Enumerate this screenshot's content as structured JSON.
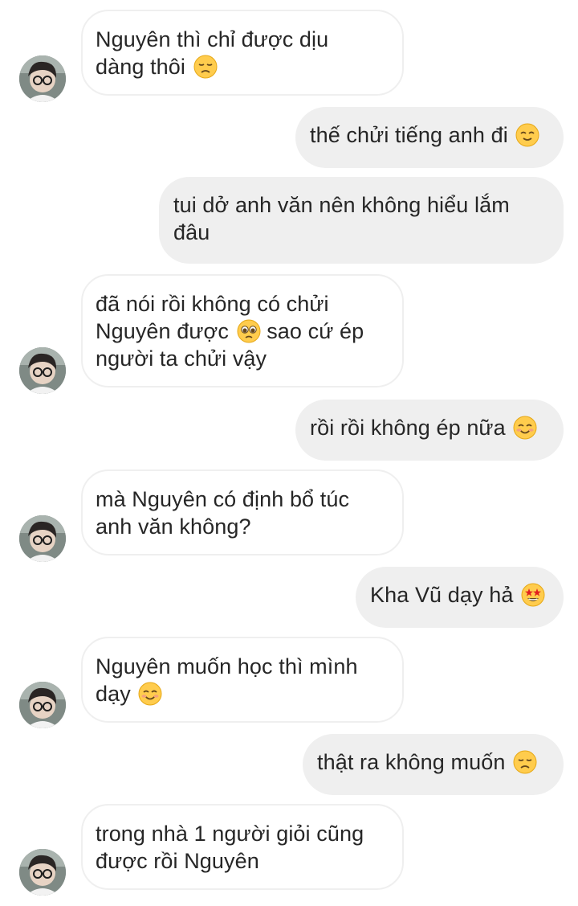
{
  "thread": {
    "messages": [
      {
        "side": "in",
        "lines": [
          "Nguyên thì chỉ được dịu",
          "dàng thôi"
        ],
        "emoji": "disappointed-face-icon",
        "avatar": true
      },
      {
        "side": "out",
        "lines": [
          "thế chửi tiếng anh đi"
        ],
        "emoji": "relieved-face-icon"
      },
      {
        "side": "out",
        "lines": [
          "tui dở anh văn nên không hiểu lắm",
          "đâu"
        ],
        "emoji": null
      },
      {
        "side": "in",
        "lines": [
          "đã nói rồi không có chửi",
          "Nguyên được",
          "sao cứ ép",
          "người ta chửi vậy"
        ],
        "emoji": "pleading-face-icon",
        "avatar": true
      },
      {
        "side": "out",
        "lines": [
          "rồi rồi không ép nữa"
        ],
        "emoji": "smiling-face-icon"
      },
      {
        "side": "in",
        "lines": [
          "mà Nguyên có định bổ túc",
          "anh văn không?"
        ],
        "emoji": null,
        "avatar": true
      },
      {
        "side": "out",
        "lines": [
          "Kha Vũ dạy hả"
        ],
        "emoji": "star-struck-face-icon"
      },
      {
        "side": "in",
        "lines": [
          "Nguyên muốn học thì mình",
          "dạy"
        ],
        "emoji": "smiling-face-icon",
        "avatar": true
      },
      {
        "side": "out",
        "lines": [
          "thật ra không muốn"
        ],
        "emoji": "disappointed-face-icon"
      },
      {
        "side": "in",
        "lines": [
          "trong nhà 1 người giỏi cũng",
          "được rồi Nguyên"
        ],
        "emoji": null,
        "avatar": true
      }
    ]
  },
  "colors": {
    "incoming_bubble_bg": "#ffffff",
    "incoming_bubble_border": "#efefef",
    "outgoing_bubble_bg": "#efefef",
    "text": "#262626",
    "emoji_face": "#ffcc4d"
  }
}
